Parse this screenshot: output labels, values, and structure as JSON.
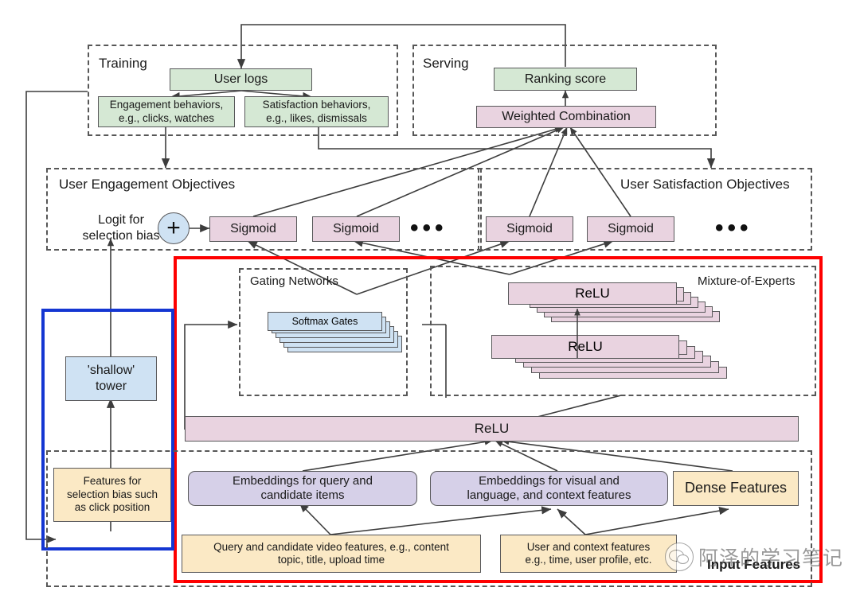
{
  "diagram": {
    "title": "Multi-objective ranking system with Mixture-of-Experts and shallow tower",
    "colors": {
      "green": "#d5e8d4",
      "pink": "#e9d3e0",
      "blue": "#cfe2f3",
      "purple": "#d6d0e8",
      "tan": "#fbe9c5",
      "red_highlight": "#fe0000",
      "blue_highlight": "#1436d2",
      "stroke": "#58585a"
    }
  },
  "groups": {
    "training": "Training",
    "serving": "Serving",
    "engagement": "User Engagement Objectives",
    "satisfaction": "User Satisfaction Objectives",
    "gating": "Gating Networks",
    "experts": "Mixture-of-Experts",
    "input_features": "Input Features"
  },
  "training": {
    "user_logs": "User logs",
    "engagement_behaviors": "Engagement behaviors,\ne.g., clicks, watches",
    "satisfaction_behaviors": "Satisfaction behaviors,\ne.g., likes, dismissals"
  },
  "serving": {
    "ranking_score": "Ranking score",
    "weighted_combination": "Weighted Combination"
  },
  "objectives": {
    "logit_label": "Logit for\nselection bias",
    "plus_symbol": "+",
    "engagement_sigmoids": [
      "Sigmoid",
      "Sigmoid"
    ],
    "satisfaction_sigmoids": [
      "Sigmoid",
      "Sigmoid"
    ],
    "ellipsis": "•••"
  },
  "gating": {
    "softmax_gates": "Softmax Gates",
    "stack_count": 6
  },
  "experts": {
    "relu_top": "ReLU",
    "relu_bottom": "ReLU",
    "stack_count": 7
  },
  "shared": {
    "relu_bar": "ReLU"
  },
  "shallow_tower": {
    "label": "'shallow'\ntower",
    "features": "Features for\nselection bias such\nas click position"
  },
  "embeddings": {
    "query_candidate": "Embeddings for query and\ncandidate items",
    "visual_language": "Embeddings for visual and\nlanguage, and context features",
    "dense_features": "Dense Features"
  },
  "raw_features": {
    "query_video": "Query and candidate video features, e.g., content\ntopic, title, upload time",
    "user_context": "User and context features\ne.g., time, user profile, etc."
  },
  "watermark": {
    "text": "阿泽的学习笔记",
    "logo": "wechat-icon"
  }
}
